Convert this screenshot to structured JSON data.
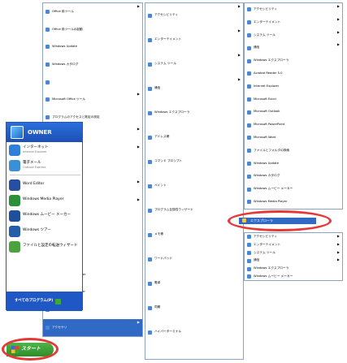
{
  "start_menu": {
    "user_name": "OWNER",
    "all_programs_label": "すべてのプログラム(P)",
    "left_items": [
      {
        "title": "インターネット",
        "subtitle": "Internet Explorer",
        "icon": "ie-icon",
        "color": "#2f7ed8"
      },
      {
        "title": "電子メール",
        "subtitle": "Outlook Express",
        "icon": "mail-icon",
        "color": "#3a8fd6"
      },
      {
        "title": "Word Editor",
        "subtitle": "",
        "icon": "word-icon",
        "color": "#284ea1"
      },
      {
        "title": "Windows Media Player",
        "subtitle": "",
        "icon": "media-player-icon",
        "color": "#2d8f3a"
      },
      {
        "title": "Windows ムービー メーカー",
        "subtitle": "",
        "icon": "movie-maker-icon",
        "color": "#1f4f9c"
      },
      {
        "title": "Windows ツアー",
        "subtitle": "",
        "icon": "tour-icon",
        "color": "#245ea8"
      },
      {
        "title": "ファイルと設定の転送ウィザード",
        "subtitle": "",
        "icon": "transfer-wizard-icon",
        "color": "#4aa33d"
      }
    ]
  },
  "start_button": {
    "label": "スタート"
  },
  "programs_col1": [
    {
      "label": "Office 用ツール",
      "arrow": true
    },
    {
      "label": "Office 用ツールの起動",
      "arrow": false
    },
    {
      "label": "Windows Update",
      "arrow": false
    },
    {
      "label": "Windows カタログ",
      "arrow": false
    },
    {
      "label": "",
      "arrow": false
    },
    {
      "label": "Microsoft Office ツール",
      "arrow": true
    },
    {
      "label": "プログラムのアクセスと既定の設定",
      "arrow": false
    },
    {
      "label": "ゲーム",
      "arrow": true
    },
    {
      "label": "スタートアップ",
      "arrow": true
    },
    {
      "label": "Adobe Reader",
      "arrow": false
    },
    {
      "label": "AOL",
      "arrow": true
    },
    {
      "label": "Microsoft Office",
      "arrow": true
    },
    {
      "label": "Internet Explorer",
      "arrow": false
    },
    {
      "label": "Windows Messenger",
      "arrow": false
    },
    {
      "label": "Outlook Express",
      "arrow": false
    },
    {
      "label": "Windows Media Player",
      "arrow": false
    },
    {
      "label": "Windows Movie Maker",
      "arrow": false
    },
    {
      "label": "Windows Update",
      "arrow": false
    },
    {
      "label": "アクセサリ",
      "arrow": true,
      "highlighted": true
    }
  ],
  "programs_col2": [
    {
      "label": "アクセシビリティ",
      "arrow": true
    },
    {
      "label": "エンターテイメント",
      "arrow": true
    },
    {
      "label": "システム ツール",
      "arrow": true
    },
    {
      "label": "通信",
      "arrow": true
    },
    {
      "label": "Windows エクスプローラ",
      "arrow": false
    },
    {
      "label": "アドレス帳",
      "arrow": false
    },
    {
      "label": "コマンド プロンプト",
      "arrow": false
    },
    {
      "label": "ペイント",
      "arrow": false
    },
    {
      "label": "プログラム互換性ウィザード",
      "arrow": false
    },
    {
      "label": "メモ帳",
      "arrow": false
    },
    {
      "label": "ワードパッド",
      "arrow": false
    },
    {
      "label": "電卓",
      "arrow": false
    },
    {
      "label": "同期",
      "arrow": false
    },
    {
      "label": "ハイパーターミナル",
      "arrow": false
    }
  ],
  "programs_col3": [
    {
      "label": "アクセシビリティ",
      "arrow": true
    },
    {
      "label": "エンターテイメント",
      "arrow": true
    },
    {
      "label": "システム ツール",
      "arrow": true
    },
    {
      "label": "通信",
      "arrow": true
    },
    {
      "label": "Windows エクスプローラ",
      "arrow": false
    },
    {
      "label": "Acrobat Reader 5.0",
      "arrow": false
    },
    {
      "label": "Internet Explorer",
      "arrow": false
    },
    {
      "label": "Microsoft Excel",
      "arrow": false
    },
    {
      "label": "Microsoft Outlook",
      "arrow": false
    },
    {
      "label": "Microsoft PowerPoint",
      "arrow": false
    },
    {
      "label": "Microsoft Word",
      "arrow": false
    },
    {
      "label": "ファイルとフォルダの検索",
      "arrow": false
    },
    {
      "label": "Windows Update",
      "arrow": false
    },
    {
      "label": "Windows カタログ",
      "arrow": false
    },
    {
      "label": "Windows ムービー メーカー",
      "arrow": false
    },
    {
      "label": "Windows Media Player",
      "arrow": false
    }
  ],
  "accessories": [
    {
      "label": "アクセシビリティ",
      "arrow": true
    },
    {
      "label": "エンターテイメント",
      "arrow": true
    },
    {
      "label": "システム ツール",
      "arrow": true
    },
    {
      "label": "通信",
      "arrow": true
    },
    {
      "label": "Windows エクスプローラ",
      "arrow": false
    },
    {
      "label": "Windows ムービー メーカー",
      "arrow": false
    }
  ],
  "system_tools": [
    {
      "label": "プログラム互換性ウィザード",
      "arrow": false
    },
    {
      "label": "メモ帳",
      "arrow": false
    },
    {
      "label": "電卓",
      "arrow": false
    },
    {
      "label": "コマンド プロンプト",
      "arrow": false
    },
    {
      "label": "ペイント",
      "arrow": false
    },
    {
      "label": "ワードパッド",
      "arrow": false
    },
    {
      "label": "同期",
      "arrow": false
    }
  ],
  "explorer_item": {
    "label": "エクスプローラ"
  }
}
